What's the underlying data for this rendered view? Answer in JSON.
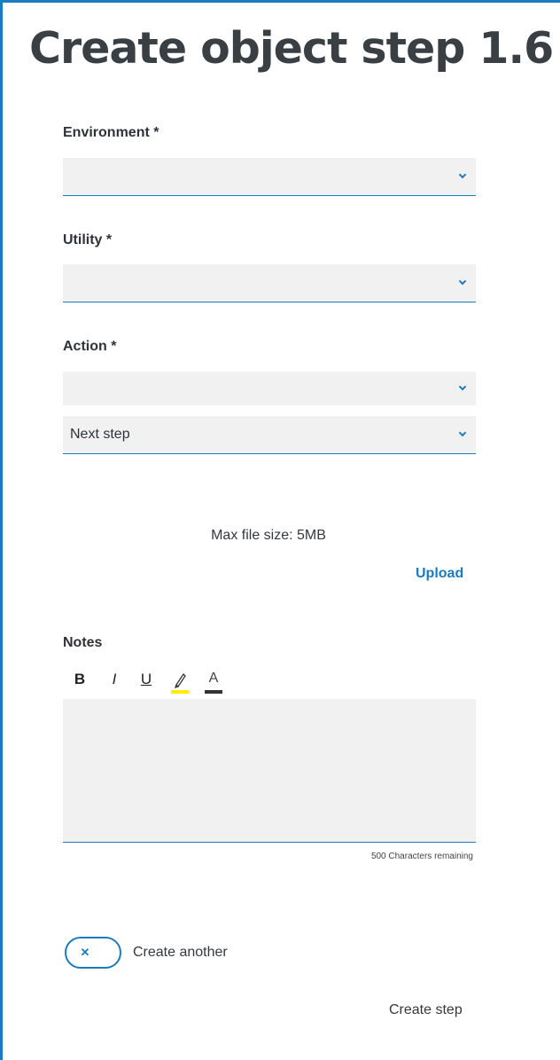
{
  "page_title": "Create object step 1.6",
  "fields": {
    "environment": {
      "label": "Environment *",
      "value": ""
    },
    "utility": {
      "label": "Utility *",
      "value": ""
    },
    "action": {
      "label": "Action *",
      "value": ""
    },
    "next_step": {
      "value": "Next step"
    }
  },
  "upload": {
    "max_size_text": "Max file size: 5MB",
    "button_label": "Upload"
  },
  "notes": {
    "label": "Notes",
    "toolbar": {
      "bold": "B",
      "italic": "I",
      "underline": "U",
      "highlight_icon": "highlighter-icon",
      "font_color_icon": "font-color-icon",
      "font_color_label": "A",
      "highlight_color": "#ffee00",
      "font_color": "#333333"
    },
    "value": "",
    "chars_remaining": "500 Characters remaining"
  },
  "create_another": {
    "label": "Create another",
    "icon": "close-icon",
    "state": "off"
  },
  "actions": {
    "create_step": "Create step"
  },
  "colors": {
    "accent": "#1a7bbf",
    "field_bg": "#f1f1f1",
    "title": "#3a3f44"
  }
}
